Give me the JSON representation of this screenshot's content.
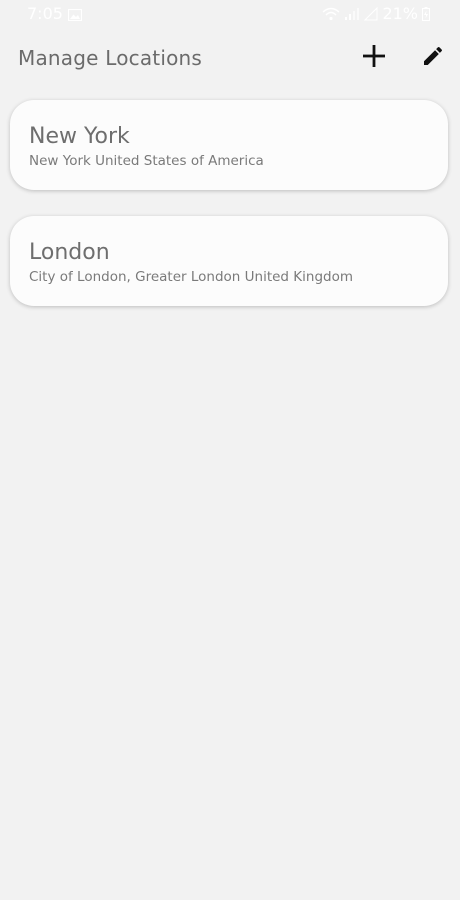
{
  "status_bar": {
    "time": "7:05",
    "battery": "21%",
    "icons": [
      "gallery-icon",
      "wifi-icon",
      "signal-icon",
      "signal-icon-2",
      "battery-icon"
    ]
  },
  "app_bar": {
    "title": "Manage Locations",
    "add_icon": "plus-icon",
    "edit_icon": "pencil-icon"
  },
  "locations": [
    {
      "name": "New York",
      "detail": "New York United States of America"
    },
    {
      "name": "London",
      "detail": "City of London, Greater London United Kingdom"
    }
  ],
  "colors": {
    "background": "#f2f2f2",
    "card": "#fcfcfc",
    "title_text": "#6b6b6b",
    "icon": "#111111"
  }
}
